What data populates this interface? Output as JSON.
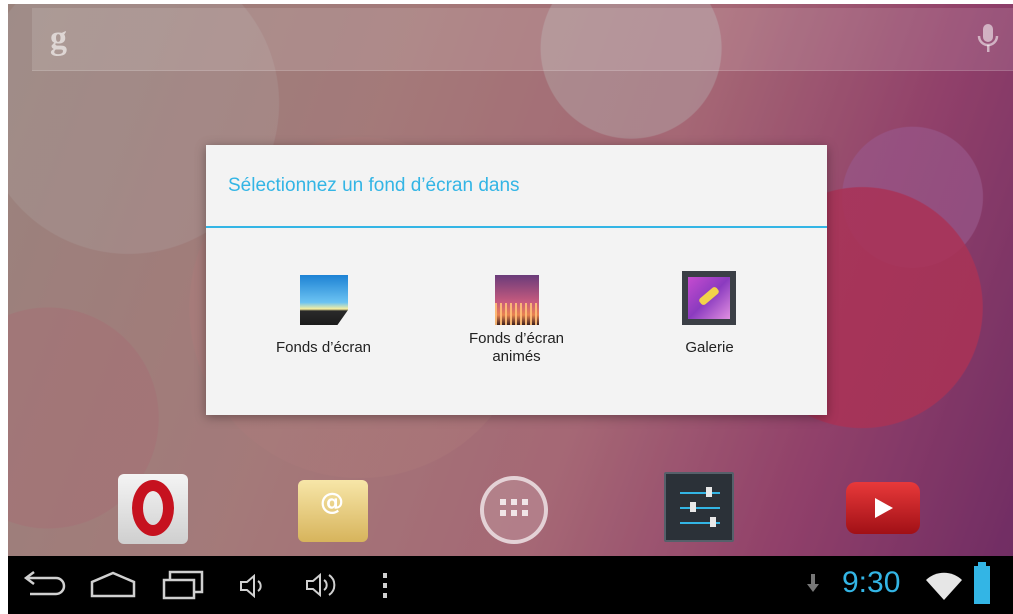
{
  "colors": {
    "accent": "#33b5e5",
    "dialog_bg": "#f3f3f3",
    "navbar_bg": "#000000"
  },
  "search_bar": {
    "google_icon": "google-g-icon",
    "mic_icon": "mic-icon"
  },
  "dialog": {
    "title": "Sélectionnez un fond d’écran dans",
    "options": [
      {
        "label": "Fonds d’écran",
        "icon": "wallpaper-icon"
      },
      {
        "label": "Fonds d’écran animés",
        "icon": "live-wallpaper-icon"
      },
      {
        "label": "Galerie",
        "icon": "gallery-icon"
      }
    ]
  },
  "dock": {
    "apps": [
      {
        "name": "opera-icon"
      },
      {
        "name": "email-icon"
      },
      {
        "name": "all-apps-icon"
      },
      {
        "name": "settings-icon"
      },
      {
        "name": "youtube-icon"
      }
    ]
  },
  "navbar": {
    "buttons": [
      "back-icon",
      "home-icon",
      "recents-icon",
      "volume-down-icon",
      "volume-up-icon",
      "menu-icon"
    ],
    "status": {
      "time": "9:30",
      "icons": [
        "download-icon",
        "wifi-icon",
        "battery-icon"
      ]
    }
  }
}
